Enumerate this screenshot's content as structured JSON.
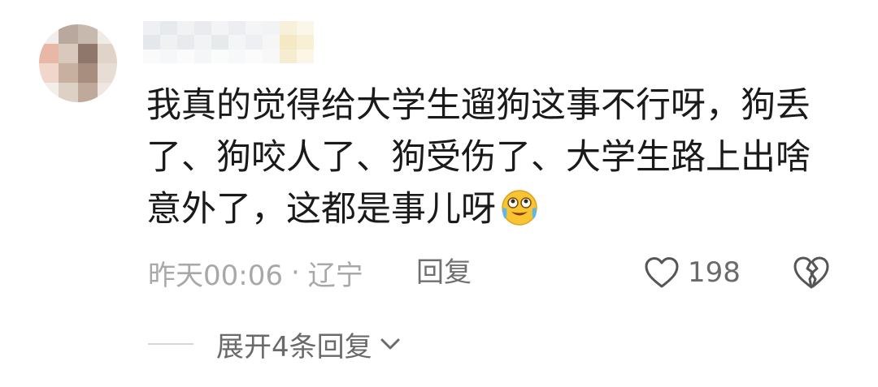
{
  "comment": {
    "text": "我真的觉得给大学生遛狗这事不行呀，狗丢了、狗咬人了、狗受伤了、大学生路上出啥意外了，这都是事儿呀",
    "emoji": "crying-laughing-emoji",
    "time": "昨天00:06",
    "separator": "·",
    "location": "辽宁",
    "reply_label": "回复",
    "like_count": "198",
    "expand_label": "展开4条回复"
  },
  "icons": {
    "like": "heart-outline-icon",
    "dislike": "broken-heart-icon",
    "expand": "chevron-down-icon"
  },
  "colors": {
    "text": "#1a1a1a",
    "meta": "#a8a8a8",
    "secondary": "#6a6a6a",
    "emoji_face": "#f7c531"
  }
}
